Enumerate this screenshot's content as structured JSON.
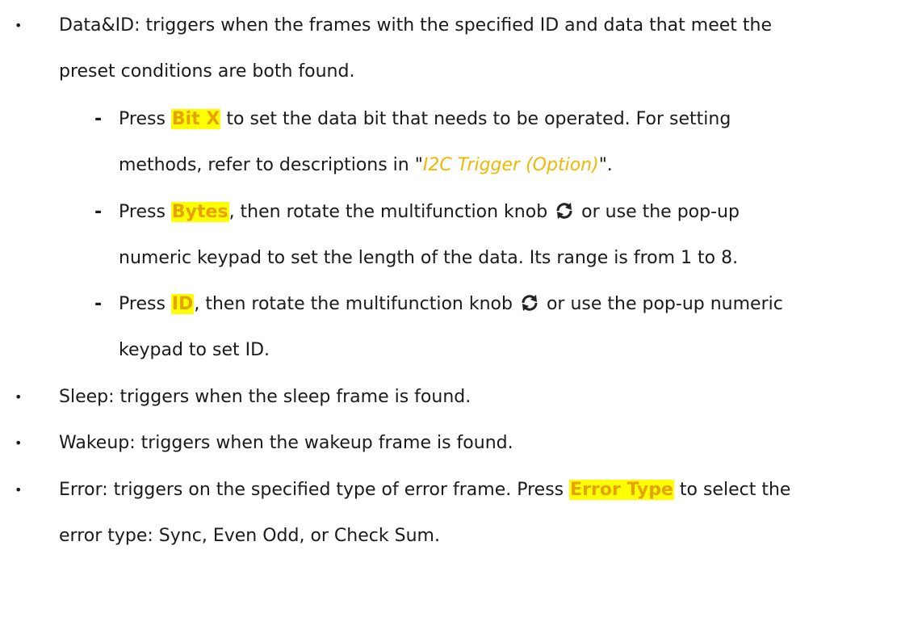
{
  "bullets": {
    "dataid": {
      "line1": "Data&ID: triggers when the frames with the specified ID and data that meet the",
      "line2": "preset conditions are both found."
    },
    "sleep": "Sleep: triggers when the sleep frame is found.",
    "wakeup": "Wakeup: triggers when the wakeup frame is found.",
    "error": {
      "prefix": "Error: triggers on the specified type of error frame. Press",
      "key": "Error Type",
      "suffix": "to select the",
      "line2": "error type: Sync, Even Odd, or Check Sum."
    }
  },
  "subitems": {
    "bitx": {
      "press": "Press",
      "key": "Bit X",
      "rest1": "to set the data bit that needs to be operated. For setting",
      "line2_pre": "methods, refer to descriptions in \"",
      "link": "I2C Trigger (Option)",
      "line2_post": "\"."
    },
    "bytes": {
      "press": "Press",
      "key": "Bytes",
      "rest1": ", then rotate the multifunction knob",
      "rest1b": "or use the pop-up",
      "line2": "numeric keypad to set the length of the data. Its range is from 1 to 8."
    },
    "id": {
      "press": "Press",
      "key": "ID",
      "rest1": ", then rotate the multifunction knob",
      "rest1b": "or use the pop-up numeric",
      "line2": "keypad to set ID."
    }
  },
  "symbols": {
    "bullet": "•",
    "dash": "-",
    "knob_icon": "rotate-arrows-icon"
  }
}
